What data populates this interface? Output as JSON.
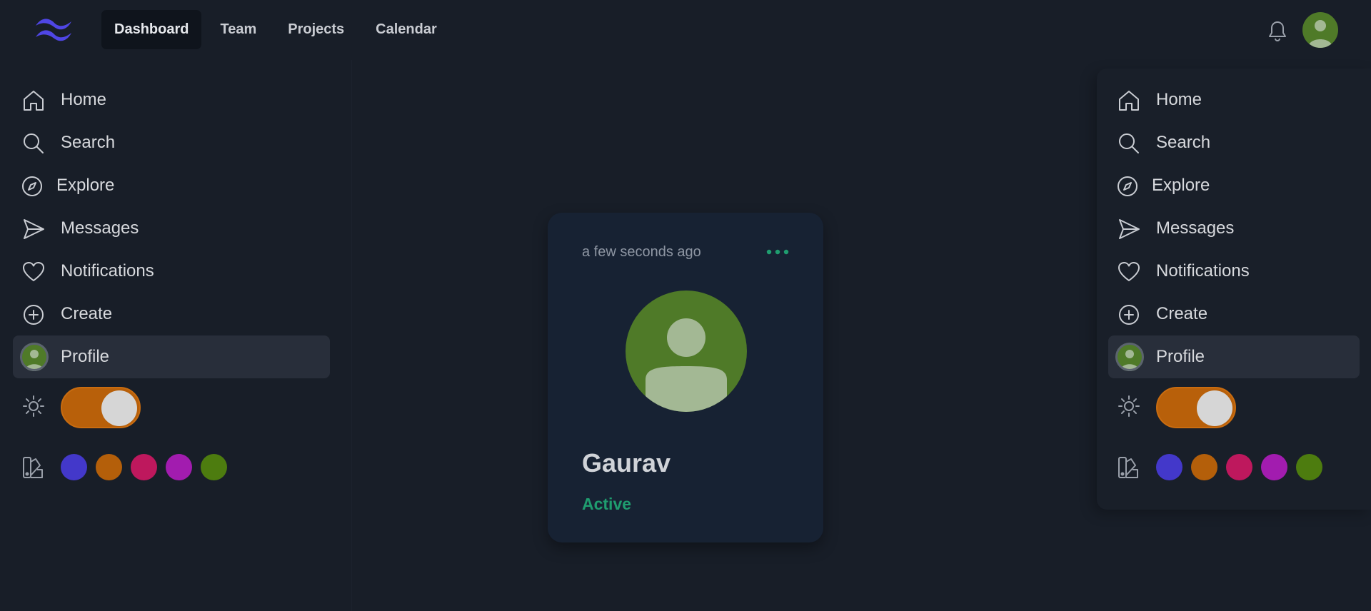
{
  "nav": {
    "tabs": [
      {
        "label": "Dashboard",
        "active": true
      },
      {
        "label": "Team"
      },
      {
        "label": "Projects"
      },
      {
        "label": "Calendar"
      }
    ]
  },
  "sidebar": {
    "items": [
      {
        "label": "Home",
        "icon": "home-icon"
      },
      {
        "label": "Search",
        "icon": "search-icon"
      },
      {
        "label": "Explore",
        "icon": "compass-icon"
      },
      {
        "label": "Messages",
        "icon": "send-icon"
      },
      {
        "label": "Notifications",
        "icon": "heart-icon"
      },
      {
        "label": "Create",
        "icon": "plus-circle-icon"
      },
      {
        "label": "Profile",
        "icon": "avatar",
        "active": true
      }
    ],
    "theme_toggle": {
      "icon": "sun-icon",
      "on": true
    },
    "palette": {
      "icon": "palette-icon",
      "swatches": [
        "#4338ca",
        "#b45f0a",
        "#be185d",
        "#a21caf",
        "#4d7c0f"
      ]
    }
  },
  "card": {
    "time": "a few seconds ago",
    "name": "Gaurav",
    "status": "Active",
    "status_color": "#1f9d6f"
  },
  "colors": {
    "background": "#181e28",
    "card": "#172233",
    "accent_toggle": "#b8600a",
    "avatar_bg": "#4f7a28"
  }
}
